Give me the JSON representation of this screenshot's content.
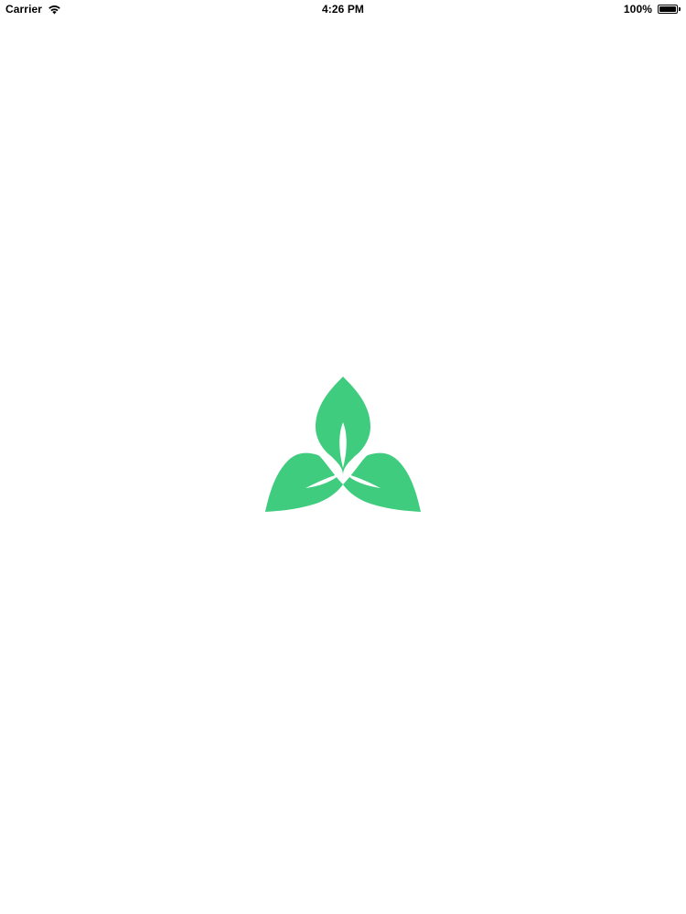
{
  "status_bar": {
    "carrier": "Carrier",
    "wifi_icon": "wifi-icon",
    "time": "4:26 PM",
    "battery_percent_label": "100%",
    "battery_level": 1.0,
    "battery_icon": "battery-icon"
  },
  "splash": {
    "logo_icon": "trillium-leaf-logo-icon",
    "logo_color": "#3FCC7E",
    "background_color": "#FFFFFF"
  }
}
